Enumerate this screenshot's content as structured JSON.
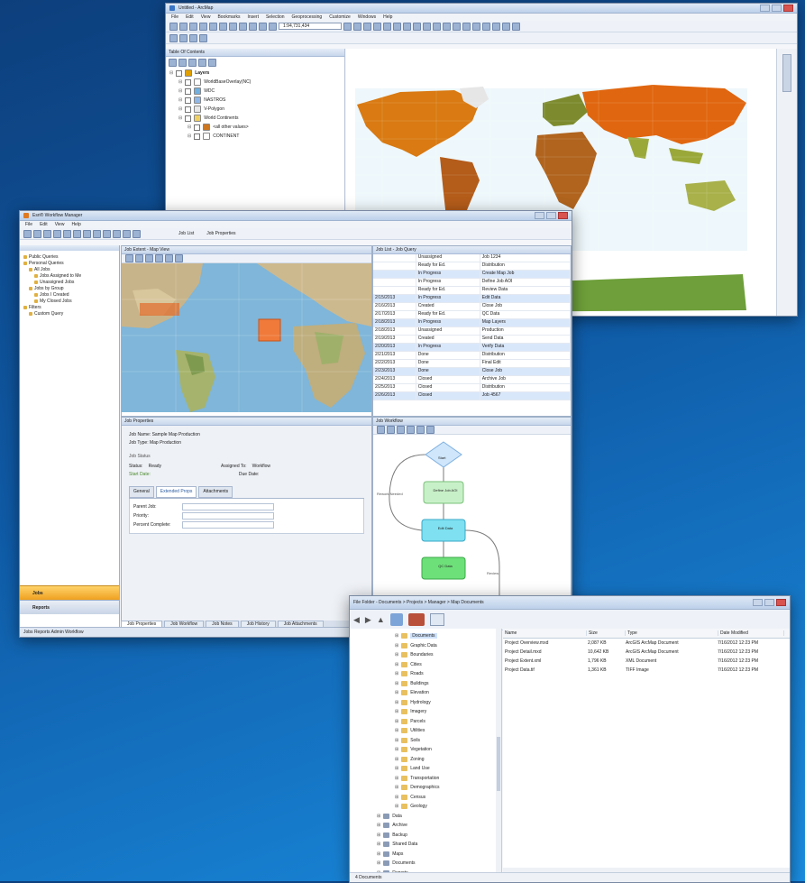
{
  "arcmap": {
    "title": "Untitled - ArcMap",
    "menu": [
      "File",
      "Edit",
      "View",
      "Bookmarks",
      "Insert",
      "Selection",
      "Geoprocessing",
      "Customize",
      "Windows",
      "Help"
    ],
    "scale": "1:94,731,434",
    "toc_title": "Table Of Contents",
    "toc": [
      {
        "label": "Layers",
        "bold": true,
        "indent": 0,
        "color": "#e0a000"
      },
      {
        "label": "WorldBaseOverlay(NC)",
        "bold": false,
        "indent": 2,
        "color": "#ffffff"
      },
      {
        "label": "WDC",
        "bold": false,
        "indent": 2,
        "color": "#6fb0e0"
      },
      {
        "label": "NASTROS",
        "bold": false,
        "indent": 2,
        "color": "#8fb8e8"
      },
      {
        "label": "V-Polygon",
        "bold": false,
        "indent": 2,
        "color": "#e8e8e8"
      },
      {
        "label": "World Continents",
        "bold": false,
        "indent": 2,
        "color": "#f0d060"
      },
      {
        "label": "<all other values>",
        "bold": false,
        "indent": 4,
        "color": "#cc7722"
      },
      {
        "label": "CONTINENT",
        "bold": false,
        "indent": 4,
        "color": "#ffffff"
      }
    ]
  },
  "sm": {
    "title": "Esri® Workflow Manager",
    "menu": [
      "File",
      "Edit",
      "View",
      "Help"
    ],
    "tabs": [
      "Job List",
      "Job Properties"
    ],
    "nav_tree": [
      "Public Queries",
      "Personal Queries",
      "All Jobs",
      "Jobs Assigned to Me",
      "Unassigned Jobs",
      "Jobs by Group",
      "Jobs I Created",
      "My Closed Jobs",
      "Filters",
      "Custom Query"
    ],
    "nav_buttons": [
      "Jobs",
      "Reports"
    ],
    "map_title": "Job Extent - Map View",
    "list_title": "Job List - Job Query",
    "props_title": "Job Properties",
    "workflow_title": "Job Workflow",
    "list_rows": [
      [
        "",
        "Unassigned",
        "Job 1234"
      ],
      [
        "",
        "Ready for Ed.",
        "Distribution"
      ],
      [
        "",
        "In Progress",
        "Create Map Job"
      ],
      [
        "",
        "In Progress",
        "Define Job AOI"
      ],
      [
        "",
        "Ready for Ed.",
        "Review Data"
      ],
      [
        "2/15/2013",
        "In Progress",
        "Edit Data"
      ],
      [
        "2/16/2013",
        "Created",
        "Close Job"
      ],
      [
        "2/17/2013",
        "Ready for Ed.",
        "QC Data"
      ],
      [
        "2/18/2013",
        "In Progress",
        "Map Layers"
      ],
      [
        "2/18/2013",
        "Unassigned",
        "Production"
      ],
      [
        "2/19/2013",
        "Created",
        "Send Data"
      ],
      [
        "2/20/2013",
        "In Progress",
        "Verify Data"
      ],
      [
        "2/21/2013",
        "Done",
        "Distribution"
      ],
      [
        "2/22/2013",
        "Done",
        "Final Edit"
      ],
      [
        "2/23/2013",
        "Done",
        "Close Job"
      ],
      [
        "2/24/2013",
        "Closed",
        "Archive Job"
      ],
      [
        "2/25/2013",
        "Closed",
        "Distribution"
      ],
      [
        "2/26/2013",
        "Closed",
        "Job 4567"
      ]
    ],
    "props": {
      "line1": "Job Name: Sample Map Production",
      "line2": "Job Type: Map Production",
      "section": "Job Status",
      "status_label": "Status:",
      "status_value": "Ready",
      "owner_label": "Assigned To:",
      "owner_value": "Workflow",
      "start_label": "Start Date:",
      "due_label": "Due Date:",
      "tabs": [
        "General",
        "Extended Props",
        "Attachments"
      ],
      "fields": [
        "Parent Job:",
        "Priority:",
        "Percent Complete:"
      ]
    },
    "flow": {
      "start": "Start",
      "step1": "Define Job AOI",
      "step2": "Edit Data",
      "step3": "QC Data",
      "loop_label": "Rework Needed",
      "side_label": "Review"
    },
    "bottom_tabs": [
      "Job Properties",
      "Job Workflow",
      "Job Notes",
      "Job History",
      "Job Attachments"
    ],
    "status_bar": "Jobs   Reports   Admin   Workflow"
  },
  "fm": {
    "title": "File Folder - Documents > Projects > Manager > Map Documents",
    "tree": [
      {
        "label": "Documents",
        "indent": 5,
        "sel": true
      },
      {
        "label": "Graphic Data",
        "indent": 5,
        "sel": false
      },
      {
        "label": "Boundaries",
        "indent": 5,
        "sel": false
      },
      {
        "label": "Cities",
        "indent": 5,
        "sel": false
      },
      {
        "label": "Roads",
        "indent": 5,
        "sel": false
      },
      {
        "label": "Buildings",
        "indent": 5,
        "sel": false
      },
      {
        "label": "Elevation",
        "indent": 5,
        "sel": false
      },
      {
        "label": "Hydrology",
        "indent": 5,
        "sel": false
      },
      {
        "label": "Imagery",
        "indent": 5,
        "sel": false
      },
      {
        "label": "Parcels",
        "indent": 5,
        "sel": false
      },
      {
        "label": "Utilities",
        "indent": 5,
        "sel": false
      },
      {
        "label": "Soils",
        "indent": 5,
        "sel": false
      },
      {
        "label": "Vegetation",
        "indent": 5,
        "sel": false
      },
      {
        "label": "Zoning",
        "indent": 5,
        "sel": false
      },
      {
        "label": "Land Use",
        "indent": 5,
        "sel": false
      },
      {
        "label": "Transportation",
        "indent": 5,
        "sel": false
      },
      {
        "label": "Demographics",
        "indent": 5,
        "sel": false
      },
      {
        "label": "Census",
        "indent": 5,
        "sel": false
      },
      {
        "label": "Geology",
        "indent": 5,
        "sel": false
      },
      {
        "label": "Data",
        "indent": 3,
        "sel": false
      },
      {
        "label": "Archive",
        "indent": 3,
        "sel": false
      },
      {
        "label": "Backup",
        "indent": 3,
        "sel": false
      },
      {
        "label": "Shared Data",
        "indent": 3,
        "sel": false
      },
      {
        "label": "Maps",
        "indent": 3,
        "sel": false
      },
      {
        "label": "Documents",
        "indent": 3,
        "sel": false
      },
      {
        "label": "Reports",
        "indent": 3,
        "sel": false
      }
    ],
    "columns": [
      "Name",
      "Size",
      "Type",
      "Date Modified"
    ],
    "files": [
      [
        "Project Overview.mxd",
        "2,087 KB",
        "ArcGIS ArcMap Document",
        "7/16/2012 12:23 PM"
      ],
      [
        "Project Detail.mxd",
        "10,642 KB",
        "ArcGIS ArcMap Document",
        "7/16/2012 12:23 PM"
      ],
      [
        "Project Extent.xml",
        "1,796 KB",
        "XML Document",
        "7/16/2012 12:23 PM"
      ],
      [
        "Project Data.tif",
        "1,361 KB",
        "TIFF Image",
        "7/16/2012 12:23 PM"
      ]
    ],
    "status": "4 Documents"
  }
}
